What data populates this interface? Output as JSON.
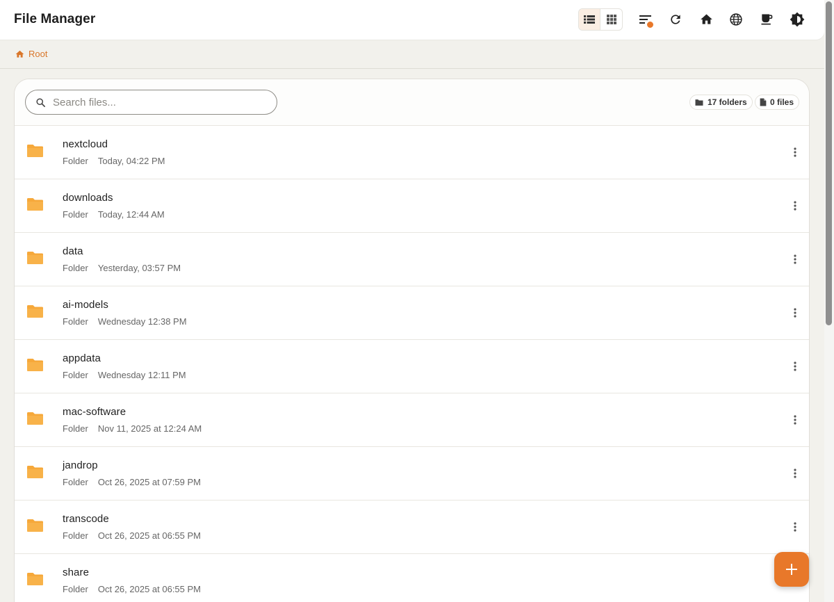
{
  "app": {
    "title": "File Manager"
  },
  "toolbar": {
    "view_list_icon": "list-view-icon",
    "view_grid_icon": "grid-view-icon",
    "icons": [
      "sort-icon",
      "refresh-icon",
      "home-icon",
      "globe-icon",
      "coffee-icon",
      "theme-icon"
    ]
  },
  "breadcrumb": {
    "root_label": "Root"
  },
  "search": {
    "placeholder": "Search files...",
    "value": ""
  },
  "counts": {
    "folders": "17 folders",
    "files": "0 files"
  },
  "items": [
    {
      "name": "nextcloud",
      "type": "Folder",
      "modified": "Today, 04:22 PM"
    },
    {
      "name": "downloads",
      "type": "Folder",
      "modified": "Today, 12:44 AM"
    },
    {
      "name": "data",
      "type": "Folder",
      "modified": "Yesterday, 03:57 PM"
    },
    {
      "name": "ai-models",
      "type": "Folder",
      "modified": "Wednesday 12:38 PM"
    },
    {
      "name": "appdata",
      "type": "Folder",
      "modified": "Wednesday 12:11 PM"
    },
    {
      "name": "mac-software",
      "type": "Folder",
      "modified": "Nov 11, 2025 at 12:24 AM"
    },
    {
      "name": "jandrop",
      "type": "Folder",
      "modified": "Oct 26, 2025 at 07:59 PM"
    },
    {
      "name": "transcode",
      "type": "Folder",
      "modified": "Oct 26, 2025 at 06:55 PM"
    },
    {
      "name": "share",
      "type": "Folder",
      "modified": "Oct 26, 2025 at 06:55 PM"
    }
  ],
  "colors": {
    "accent": "#e8782a",
    "folder": "#f6a83a",
    "background": "#f2f1ec"
  }
}
